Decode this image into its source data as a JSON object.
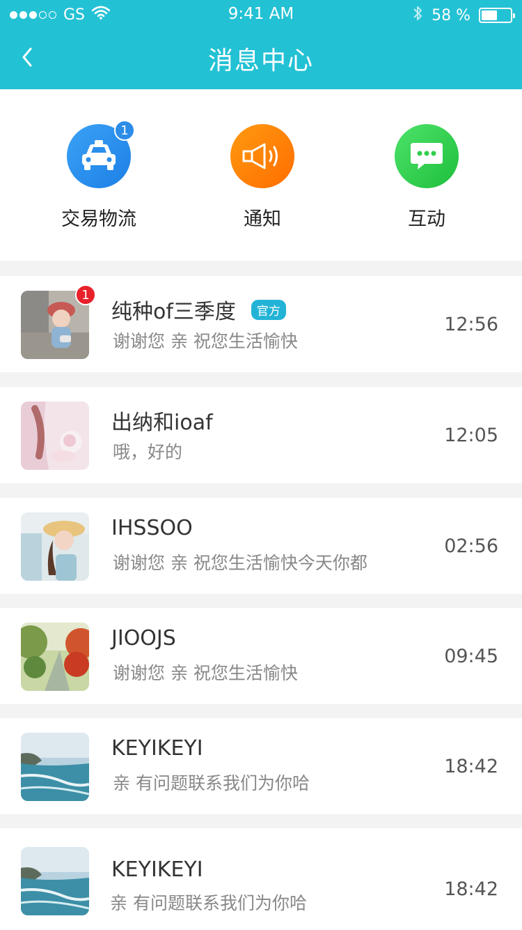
{
  "status_bar": {
    "carrier": "GS",
    "time": "9:41 AM",
    "battery_text": "58 %"
  },
  "nav": {
    "title": "消息中心",
    "back_icon": "chevron-left-icon"
  },
  "categories": [
    {
      "label": "交易物流",
      "icon": "taxi-icon",
      "badge": "1",
      "color_from": "#3aa2f5",
      "color_to": "#1d7fe6"
    },
    {
      "label": "通知",
      "icon": "megaphone-icon",
      "badge": "",
      "color_from": "#ff9a10",
      "color_to": "#ff6d00"
    },
    {
      "label": "互动",
      "icon": "chat-bubble-icon",
      "badge": "",
      "color_from": "#4de26a",
      "color_to": "#1fbf3c"
    }
  ],
  "conversations": [
    {
      "name": "纯种of三季度",
      "tag": "官方",
      "message": "谢谢您 亲 祝您生活愉快",
      "time": "12:56",
      "badge": "1"
    },
    {
      "name": "出纳和ioaf",
      "tag": "",
      "message": "哦，好的",
      "time": "12:05",
      "badge": ""
    },
    {
      "name": "IHSSOO",
      "tag": "",
      "message": "谢谢您 亲 祝您生活愉快今天你都",
      "time": "02:56",
      "badge": ""
    },
    {
      "name": "JIOOJS",
      "tag": "",
      "message": "谢谢您 亲 祝您生活愉快",
      "time": "09:45",
      "badge": ""
    },
    {
      "name": "KEYIKEYI",
      "tag": "",
      "message": "亲  有问题联系我们为你哈",
      "time": "18:42",
      "badge": ""
    },
    {
      "name": "KEYIKEYI",
      "tag": "",
      "message": "亲  有问题联系我们为你哈",
      "time": "18:42",
      "badge": ""
    }
  ],
  "colors": {
    "header": "#23c1d4",
    "official_tag": "#23b3d6",
    "badge_red": "#e8212a"
  }
}
